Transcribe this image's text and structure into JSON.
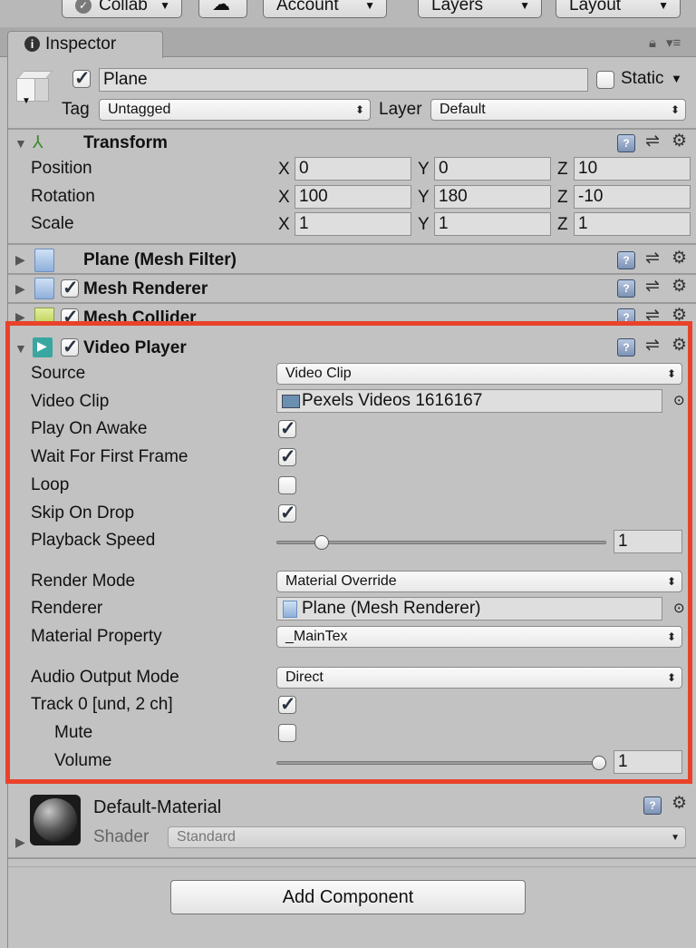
{
  "toolbar": {
    "collab": "Collab",
    "account": "Account",
    "layers": "Layers",
    "layout": "Layout"
  },
  "tab": {
    "label": "Inspector"
  },
  "gameobject": {
    "active": true,
    "name": "Plane",
    "static_label": "Static",
    "static": false,
    "tag_label": "Tag",
    "tag": "Untagged",
    "layer_label": "Layer",
    "layer": "Default"
  },
  "transform": {
    "title": "Transform",
    "rows": [
      {
        "label": "Position",
        "x": "0",
        "y": "0",
        "z": "10"
      },
      {
        "label": "Rotation",
        "x": "100",
        "y": "180",
        "z": "-10"
      },
      {
        "label": "Scale",
        "x": "1",
        "y": "1",
        "z": "1"
      }
    ],
    "axis_x": "X",
    "axis_y": "Y",
    "axis_z": "Z"
  },
  "components": {
    "mesh_filter": "Plane (Mesh Filter)",
    "mesh_renderer": "Mesh Renderer",
    "mesh_collider": "Mesh Collider"
  },
  "video_player": {
    "title": "Video Player",
    "source_label": "Source",
    "source": "Video Clip",
    "video_clip_label": "Video Clip",
    "video_clip": "Pexels Videos 1616167",
    "play_on_awake_label": "Play On Awake",
    "play_on_awake": true,
    "wait_first_frame_label": "Wait For First Frame",
    "wait_first_frame": true,
    "loop_label": "Loop",
    "loop": false,
    "skip_on_drop_label": "Skip On Drop",
    "skip_on_drop": true,
    "playback_speed_label": "Playback Speed",
    "playback_speed": "1",
    "playback_slider_fraction": 0.12,
    "render_mode_label": "Render Mode",
    "render_mode": "Material Override",
    "renderer_label": "Renderer",
    "renderer": "Plane (Mesh Renderer)",
    "material_property_label": "Material Property",
    "material_property": "_MainTex",
    "audio_output_label": "Audio Output Mode",
    "audio_output": "Direct",
    "track_label": "Track 0 [und, 2 ch]",
    "track": true,
    "mute_label": "Mute",
    "mute": false,
    "volume_label": "Volume",
    "volume": "1",
    "volume_slider_fraction": 1.0
  },
  "material": {
    "name": "Default-Material",
    "shader_label": "Shader",
    "shader": "Standard"
  },
  "add_component": "Add Component",
  "colors": {
    "highlight": "#e8432a",
    "panel": "#c2c2c2"
  }
}
